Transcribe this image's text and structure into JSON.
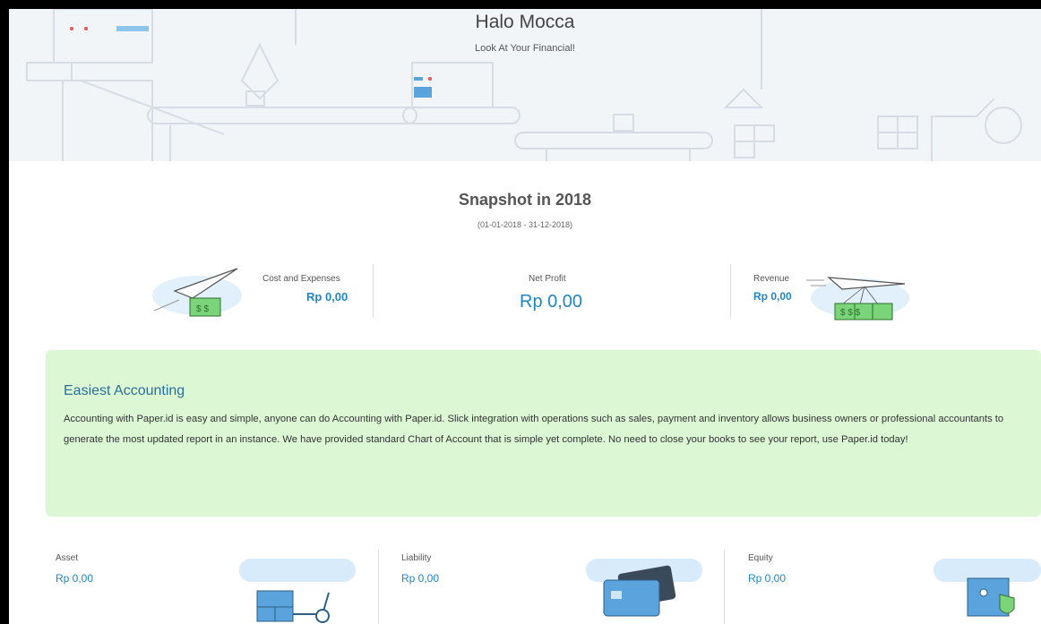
{
  "header": {
    "greeting": "Halo Mocca",
    "subtitle": "Look At Your Financial!"
  },
  "snapshot": {
    "title": "Snapshot in 2018",
    "range": "(01-01-2018 - 31-12-2018)",
    "cost": {
      "label": "Cost and Expenses",
      "value": "Rp 0,00"
    },
    "profit": {
      "label": "Net Profit",
      "value": "Rp 0,00"
    },
    "revenue": {
      "label": "Revenue",
      "value": "Rp 0,00"
    }
  },
  "info_box": {
    "title": "Easiest Accounting",
    "text": "Accounting with Paper.id is easy and simple, anyone can do Accounting with Paper.id. Slick integration with operations such as sales, payment and inventory allows business owners or professional accountants to generate the most updated report in an instance. We have provided standard Chart of Account that is simple yet complete. No need to close your books to see your report, use Paper.id today!"
  },
  "balance": {
    "asset": {
      "label": "Asset",
      "value": "Rp 0,00"
    },
    "liability": {
      "label": "Liability",
      "value": "Rp 0,00"
    },
    "equity": {
      "label": "Equity",
      "value": "Rp 0,00"
    }
  },
  "colors": {
    "accent": "#1f86c6",
    "box_bg": "#dcf7d4",
    "hero_bg": "#f2f5f8"
  }
}
